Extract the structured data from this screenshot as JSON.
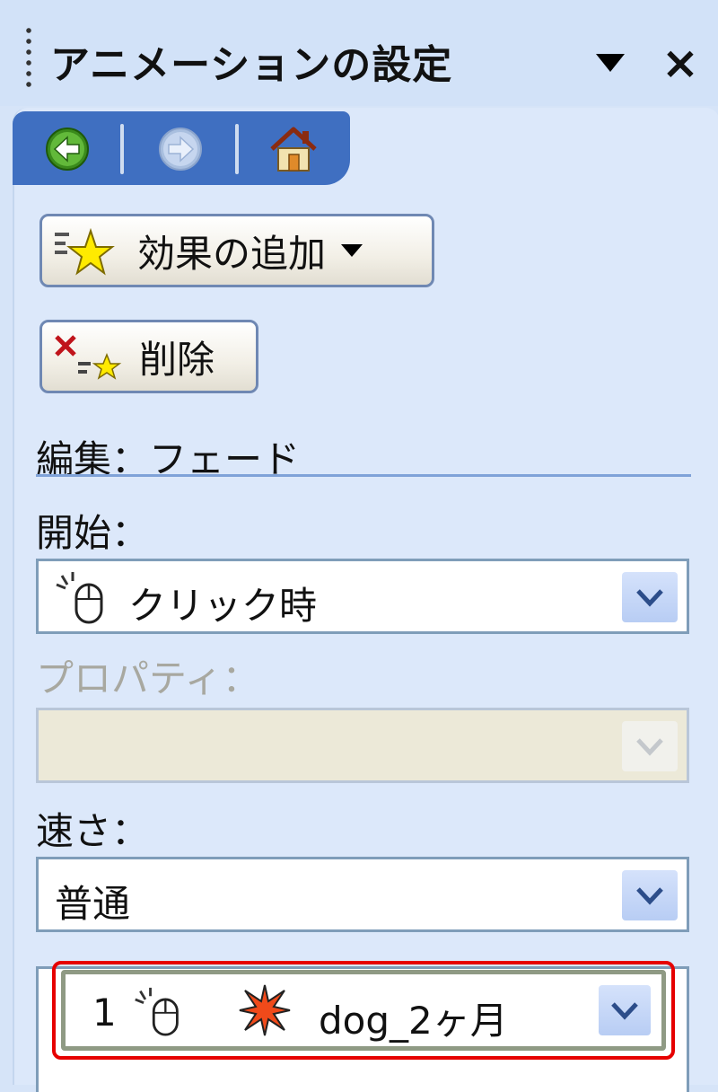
{
  "pane": {
    "title": "アニメーションの設定",
    "close_glyph": "×"
  },
  "nav": {
    "back_icon": "back-arrow-icon",
    "forward_icon": "forward-arrow-icon",
    "home_icon": "home-icon"
  },
  "buttons": {
    "add_effect_label": "効果の追加",
    "remove_label": "削除"
  },
  "edit_label": "編集：フェード",
  "start": {
    "label": "開始：",
    "value": "クリック時"
  },
  "property": {
    "label": "プロパティ：",
    "value": ""
  },
  "speed": {
    "label": "速さ：",
    "value": "普通"
  },
  "effects_list": [
    {
      "order": "1",
      "name": "dog_2ヶ月"
    }
  ],
  "colors": {
    "pane_bg": "#d6e4f8",
    "nav_tab": "#3f6fc1",
    "highlight_frame": "#e60000"
  }
}
